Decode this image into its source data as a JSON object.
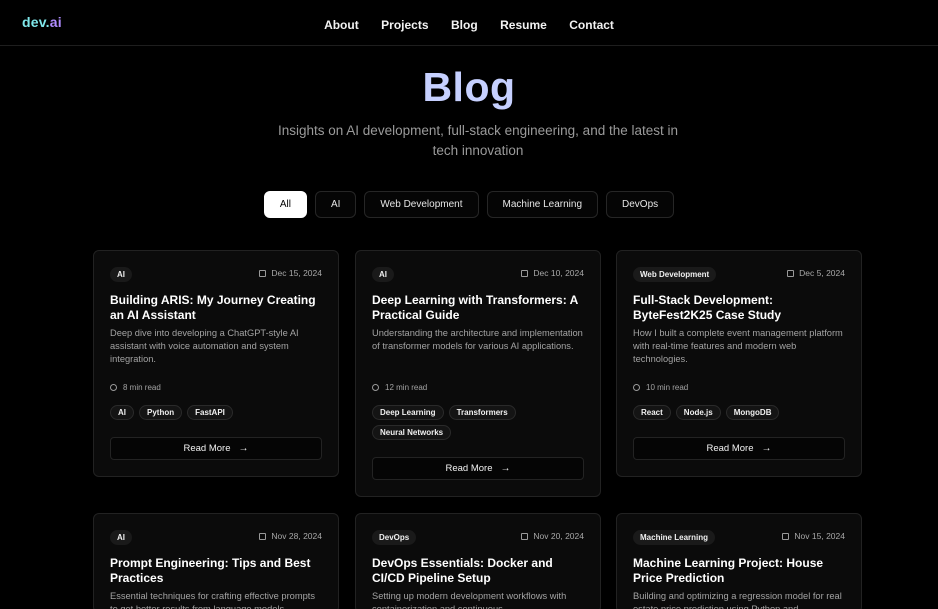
{
  "header": {
    "logo_part1": "dev.",
    "logo_part2": "ai",
    "nav": [
      "About",
      "Projects",
      "Blog",
      "Resume",
      "Contact"
    ]
  },
  "hero": {
    "title": "Blog",
    "subtitle": "Insights on AI development, full-stack engineering, and the latest in tech innovation"
  },
  "filters": {
    "items": [
      "All",
      "AI",
      "Web Development",
      "Machine Learning",
      "DevOps"
    ],
    "active": "All"
  },
  "posts": [
    {
      "category": "AI",
      "date": "Dec 15, 2024",
      "title": "Building ARIS: My Journey Creating an AI Assistant",
      "description": "Deep dive into developing a ChatGPT-style AI assistant with voice automation and system integration.",
      "read_time": "8 min read",
      "tags": [
        "AI",
        "Python",
        "FastAPI"
      ],
      "cta": "Read More"
    },
    {
      "category": "AI",
      "date": "Dec 10, 2024",
      "title": "Deep Learning with Transformers: A Practical Guide",
      "description": "Understanding the architecture and implementation of transformer models for various AI applications.",
      "read_time": "12 min read",
      "tags": [
        "Deep Learning",
        "Transformers",
        "Neural Networks"
      ],
      "cta": "Read More"
    },
    {
      "category": "Web Development",
      "date": "Dec 5, 2024",
      "title": "Full-Stack Development: ByteFest2K25 Case Study",
      "description": "How I built a complete event management platform with real-time features and modern web technologies.",
      "read_time": "10 min read",
      "tags": [
        "React",
        "Node.js",
        "MongoDB"
      ],
      "cta": "Read More"
    },
    {
      "category": "AI",
      "date": "Nov 28, 2024",
      "title": "Prompt Engineering: Tips and Best Practices",
      "description": "Essential techniques for crafting effective prompts to get better results from language models.",
      "read_time": "",
      "tags": [],
      "cta": ""
    },
    {
      "category": "DevOps",
      "date": "Nov 20, 2024",
      "title": "DevOps Essentials: Docker and CI/CD Pipeline Setup",
      "description": "Setting up modern development workflows with containerization and continuous",
      "read_time": "",
      "tags": [],
      "cta": ""
    },
    {
      "category": "Machine Learning",
      "date": "Nov 15, 2024",
      "title": "Machine Learning Project: House Price Prediction",
      "description": "Building and optimizing a regression model for real estate price prediction using Python and",
      "read_time": "",
      "tags": [],
      "cta": ""
    }
  ]
}
